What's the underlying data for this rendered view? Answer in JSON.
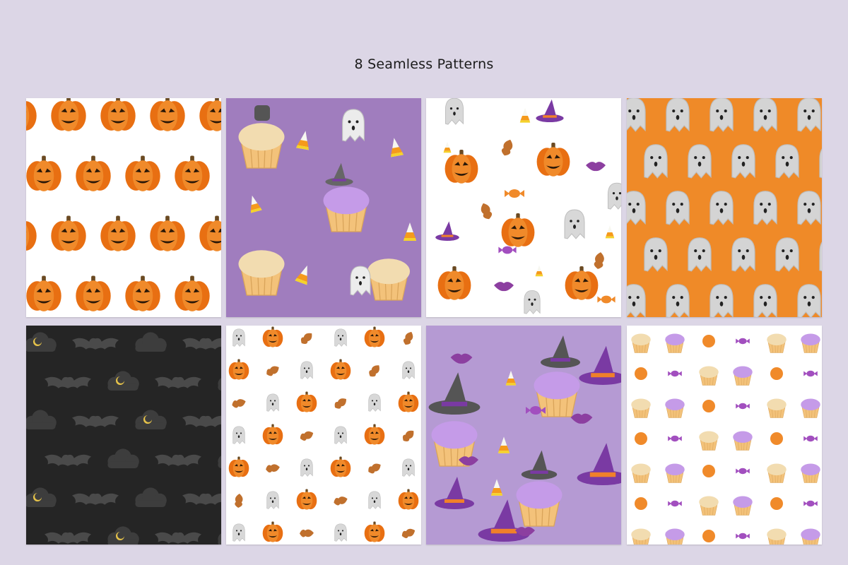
{
  "header": {
    "title": "8 Seamless Patterns"
  },
  "patterns": [
    {
      "theme": "pumpkins",
      "background": "#ffffff"
    },
    {
      "theme": "cupcakes-candy-corn",
      "background": "#a07dbe"
    },
    {
      "theme": "mixed-halloween",
      "background": "#ffffff"
    },
    {
      "theme": "ghosts",
      "background": "#ef8a28"
    },
    {
      "theme": "bats-clouds-moons",
      "background": "#252525"
    },
    {
      "theme": "small-ghosts-pumpkins-leaves",
      "background": "#ffffff"
    },
    {
      "theme": "witch-hats-cupcakes-lips",
      "background": "#b59ad3"
    },
    {
      "theme": "small-cupcakes-candies",
      "background": "#ffffff"
    }
  ]
}
